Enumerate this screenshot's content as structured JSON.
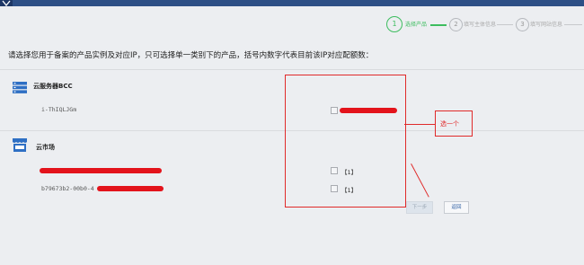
{
  "steps": [
    {
      "number": "1",
      "label": "选择产品"
    },
    {
      "number": "2",
      "label": "填写主体信息"
    },
    {
      "number": "3",
      "label": "填写网站信息"
    }
  ],
  "instruction": "请选择您用于备案的产品实例及对应IP，只可选择单一类别下的产品，括号内数字代表目前该IP对应配额数：",
  "products": [
    {
      "name": "云服务器BCC",
      "icon": "server-stack-icon",
      "instances": [
        {
          "id": "i-ThIQLJGm",
          "quota": ""
        }
      ]
    },
    {
      "name": "云市场",
      "icon": "storefront-icon",
      "instances": [
        {
          "id": "",
          "quota": "【1】"
        },
        {
          "id": "b79673b2-00b0-4",
          "quota": "【1】"
        }
      ]
    }
  ],
  "annotation": {
    "text": "选一个",
    "color": "#e02a2a"
  },
  "buttons": {
    "next": "下一步",
    "back": "返回"
  },
  "colors": {
    "accent": "#3dbd5f",
    "header": "#2d4f86",
    "annotation": "#e02a2a"
  }
}
